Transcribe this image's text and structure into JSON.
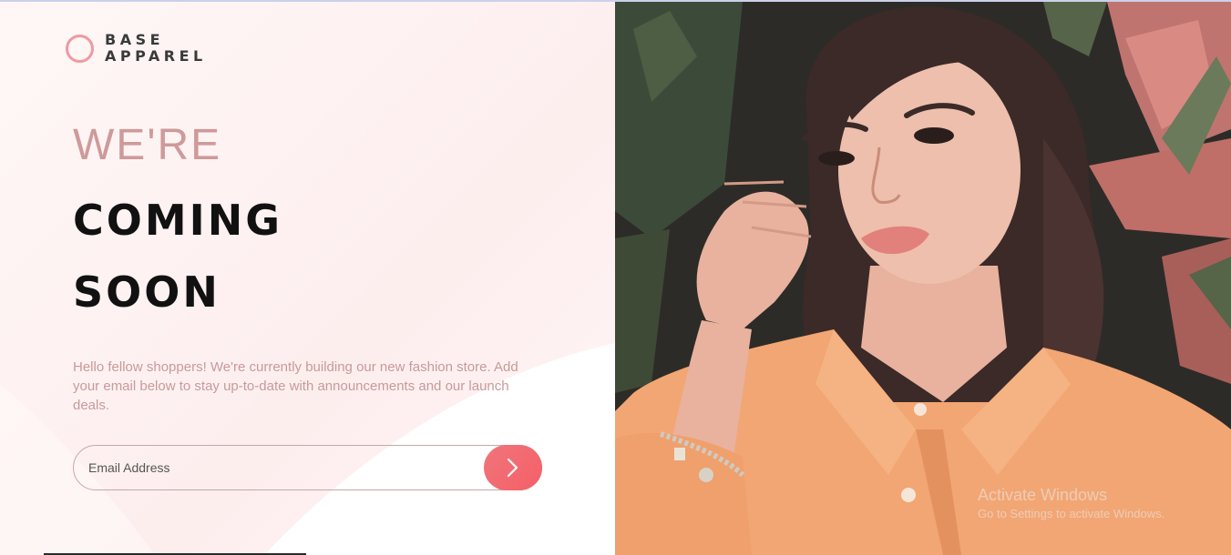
{
  "brand": {
    "line1": "BASE",
    "line2": "APPAREL",
    "logo_icon": "circle-logo-icon",
    "accent_color": "#ee9aa0"
  },
  "hero": {
    "line1": "WE'RE",
    "line2": "COMING",
    "line3": "SOON"
  },
  "description": "Hello fellow shoppers! We're currently building our new fashion store. Add your email below to stay up-to-date with announcements and our launch deals.",
  "form": {
    "email_placeholder": "Email Address",
    "email_value": "",
    "submit_icon": "chevron-right-icon",
    "button_color": "#f5656d"
  },
  "hero_image": {
    "subject": "woman-in-orange-shirt-photo"
  },
  "os_watermark": {
    "title": "Activate Windows",
    "subtitle": "Go to Settings to activate Windows."
  }
}
